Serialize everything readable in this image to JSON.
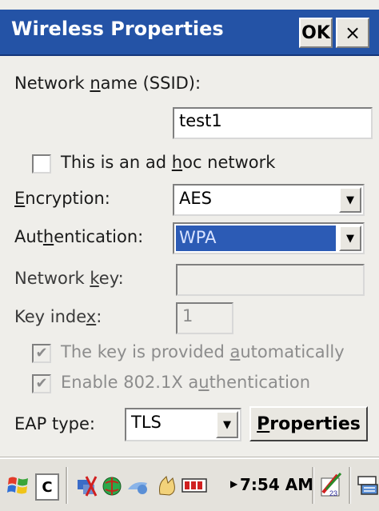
{
  "window": {
    "title": "Wireless Properties",
    "ok_label": "OK",
    "close_label": "×"
  },
  "form": {
    "ssid_label_pre": "Network ",
    "ssid_label_u": "n",
    "ssid_label_post": "ame (SSID):",
    "ssid_value": "test1",
    "adhoc_label_pre": "This is an ad ",
    "adhoc_label_u": "h",
    "adhoc_label_post": "oc network",
    "adhoc_checked": false,
    "encryption_label_u": "E",
    "encryption_label_post": "ncryption:",
    "encryption_value": "AES",
    "auth_label_pre": "Aut",
    "auth_label_u": "h",
    "auth_label_post": "entication:",
    "auth_value": "WPA",
    "netkey_label_pre": "Network ",
    "netkey_label_u": "k",
    "netkey_label_post": "ey:",
    "netkey_value": "",
    "keyindex_label_pre": "Key inde",
    "keyindex_label_u": "x",
    "keyindex_label_post": ":",
    "keyindex_value": "1",
    "auto_key_label_pre": "The key is provided ",
    "auto_key_label_u": "a",
    "auto_key_label_post": "utomatically",
    "auto_key_checked": true,
    "enable_8021x_label_pre": "Enable 802.1X a",
    "enable_8021x_label_u": "u",
    "enable_8021x_label_post": "thentication",
    "enable_8021x_checked": true,
    "eap_label": "EAP type:",
    "eap_value": "TLS",
    "properties_label_u": "P",
    "properties_label_post": "roperties"
  },
  "taskbar": {
    "c_label": "C",
    "time": "7:54 AM",
    "calendar_day": "23"
  },
  "colors": {
    "titlebar": "#2453a6",
    "selection": "#2c5bb5",
    "face": "#efeeea"
  }
}
